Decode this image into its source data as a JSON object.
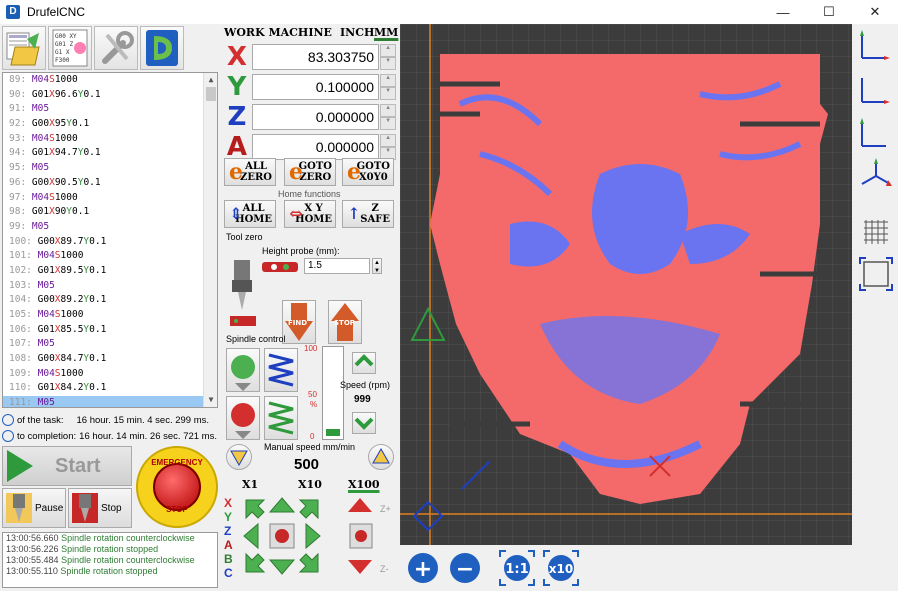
{
  "app": {
    "title": "DrufelCNC",
    "icon": "app-icon"
  },
  "window_controls": {
    "minimize": "—",
    "maximize": "☐",
    "close": "✕"
  },
  "toolbar": {
    "open_file": "open-file-icon",
    "gcode_text": "G01 XY\nG01 Z\nG1 X\nG0 F300",
    "settings": "settings-icon",
    "logo": "drufel-logo-icon"
  },
  "gcode_lines": [
    {
      "n": "89:",
      "parts": [
        [
          "cm",
          "M04"
        ],
        [
          "cx",
          "S"
        ],
        [
          "",
          "1000"
        ]
      ]
    },
    {
      "n": "90:",
      "parts": [
        [
          "",
          "G01"
        ],
        [
          "cx",
          "X"
        ],
        [
          "",
          "96.6"
        ],
        [
          "cy",
          "Y"
        ],
        [
          "",
          "0.1"
        ]
      ]
    },
    {
      "n": "91:",
      "parts": [
        [
          "cm",
          "M05"
        ]
      ]
    },
    {
      "n": "92:",
      "parts": [
        [
          "",
          "G00"
        ],
        [
          "cx",
          "X"
        ],
        [
          "",
          "95"
        ],
        [
          "cy",
          "Y"
        ],
        [
          "",
          "0.1"
        ]
      ]
    },
    {
      "n": "93:",
      "parts": [
        [
          "cm",
          "M04"
        ],
        [
          "cx",
          "S"
        ],
        [
          "",
          "1000"
        ]
      ]
    },
    {
      "n": "94:",
      "parts": [
        [
          "",
          "G01"
        ],
        [
          "cx",
          "X"
        ],
        [
          "",
          "94.7"
        ],
        [
          "cy",
          "Y"
        ],
        [
          "",
          "0.1"
        ]
      ]
    },
    {
      "n": "95:",
      "parts": [
        [
          "cm",
          "M05"
        ]
      ]
    },
    {
      "n": "96:",
      "parts": [
        [
          "",
          "G00"
        ],
        [
          "cx",
          "X"
        ],
        [
          "",
          "90.5"
        ],
        [
          "cy",
          "Y"
        ],
        [
          "",
          "0.1"
        ]
      ]
    },
    {
      "n": "97:",
      "parts": [
        [
          "cm",
          "M04"
        ],
        [
          "cx",
          "S"
        ],
        [
          "",
          "1000"
        ]
      ]
    },
    {
      "n": "98:",
      "parts": [
        [
          "",
          "G01"
        ],
        [
          "cx",
          "X"
        ],
        [
          "",
          "90"
        ],
        [
          "cy",
          "Y"
        ],
        [
          "",
          "0.1"
        ]
      ]
    },
    {
      "n": "99:",
      "parts": [
        [
          "cm",
          "M05"
        ]
      ]
    },
    {
      "n": "100:",
      "parts": [
        [
          "",
          "G00"
        ],
        [
          "cx",
          "X"
        ],
        [
          "",
          "89.7"
        ],
        [
          "cy",
          "Y"
        ],
        [
          "",
          "0.1"
        ]
      ]
    },
    {
      "n": "101:",
      "parts": [
        [
          "cm",
          "M04"
        ],
        [
          "cx",
          "S"
        ],
        [
          "",
          "1000"
        ]
      ]
    },
    {
      "n": "102:",
      "parts": [
        [
          "",
          "G01"
        ],
        [
          "cx",
          "X"
        ],
        [
          "",
          "89.5"
        ],
        [
          "cy",
          "Y"
        ],
        [
          "",
          "0.1"
        ]
      ]
    },
    {
      "n": "103:",
      "parts": [
        [
          "cm",
          "M05"
        ]
      ]
    },
    {
      "n": "104:",
      "parts": [
        [
          "",
          "G00"
        ],
        [
          "cx",
          "X"
        ],
        [
          "",
          "89.2"
        ],
        [
          "cy",
          "Y"
        ],
        [
          "",
          "0.1"
        ]
      ]
    },
    {
      "n": "105:",
      "parts": [
        [
          "cm",
          "M04"
        ],
        [
          "cx",
          "S"
        ],
        [
          "",
          "1000"
        ]
      ]
    },
    {
      "n": "106:",
      "parts": [
        [
          "",
          "G01"
        ],
        [
          "cx",
          "X"
        ],
        [
          "",
          "85.5"
        ],
        [
          "cy",
          "Y"
        ],
        [
          "",
          "0.1"
        ]
      ]
    },
    {
      "n": "107:",
      "parts": [
        [
          "cm",
          "M05"
        ]
      ]
    },
    {
      "n": "108:",
      "parts": [
        [
          "",
          "G00"
        ],
        [
          "cx",
          "X"
        ],
        [
          "",
          "84.7"
        ],
        [
          "cy",
          "Y"
        ],
        [
          "",
          "0.1"
        ]
      ]
    },
    {
      "n": "109:",
      "parts": [
        [
          "cm",
          "M04"
        ],
        [
          "cx",
          "S"
        ],
        [
          "",
          "1000"
        ]
      ]
    },
    {
      "n": "110:",
      "parts": [
        [
          "",
          "G01"
        ],
        [
          "cx",
          "X"
        ],
        [
          "",
          "84.2"
        ],
        [
          "cy",
          "Y"
        ],
        [
          "",
          "0.1"
        ]
      ]
    },
    {
      "n": "111:",
      "parts": [
        [
          "cm",
          "M05"
        ]
      ],
      "selected": true
    }
  ],
  "time": {
    "task_label": "of the task:",
    "task_value": "16 hour. 15 min. 4 sec. 299 ms.",
    "completion_label": "to completion:",
    "completion_value": "16 hour. 14 min. 26 sec. 721 ms."
  },
  "controls": {
    "start": "Start",
    "pause": "Pause",
    "stop": "Stop",
    "estop_top": "EMERGENCY",
    "estop_bottom": "STOP"
  },
  "log": [
    {
      "t": "13:00:56.660",
      "msg": "Spindle rotation counterclockwise"
    },
    {
      "t": "13:00:56.226",
      "msg": "Spindle rotation stopped"
    },
    {
      "t": "13:00:55.484",
      "msg": "Spindle rotation counterclockwise"
    },
    {
      "t": "13:00:55.110",
      "msg": "Spindle rotation stopped"
    }
  ],
  "axes": {
    "header": "WORK MACHINE",
    "inch": "INCH",
    "mm": "MM",
    "rows": [
      {
        "letter": "X",
        "color": "#d32f2f",
        "value": "83.303750"
      },
      {
        "letter": "Y",
        "color": "#2e9a3c",
        "value": "0.100000"
      },
      {
        "letter": "Z",
        "color": "#1e3fbf",
        "value": "0.000000"
      },
      {
        "letter": "A",
        "color": "#b71c1c",
        "value": "0.000000"
      }
    ]
  },
  "home": {
    "all_zero": "ALL\nZERO",
    "goto_zero": "GOTO\nZERO",
    "goto_x0y0": "GOTO\nX0Y0",
    "functions_label": "Home functions",
    "all_home": "ALL\nHOME",
    "xy_home": "X Y\nHOME",
    "z_safe": "Z\nSAFE"
  },
  "tool_zero": {
    "label": "Tool zero",
    "height_probe_label": "Height probe (mm):",
    "height_probe_value": "1.5",
    "find": "FIND",
    "stop": "STOP"
  },
  "spindle": {
    "label": "Spindle control",
    "max": "100",
    "mid": "50",
    "unit": "%",
    "min": "0",
    "level_fraction": 0.08,
    "speed_label": "Speed (rpm)",
    "speed_value": "999"
  },
  "manual_speed": {
    "label": "Manual speed mm/min",
    "value": "500",
    "x1": "X1",
    "x10": "X10",
    "x100": "X100"
  },
  "jog_axes": [
    "X",
    "Y",
    "Z",
    "A",
    "B",
    "C"
  ],
  "jog_labels": {
    "z_plus": "Z+",
    "z_minus": "Z-"
  },
  "zoom": {
    "zoom_in": "+",
    "zoom_out": "−",
    "one_to_one": "1:1",
    "x10": "x10"
  },
  "view_buttons": [
    "view-top-icon",
    "view-front-icon",
    "view-side-icon",
    "view-iso-icon",
    "grid-icon",
    "frame-icon"
  ],
  "colors": {
    "accent_green": "#2e9a3c",
    "engrave_red": "#f46a6a",
    "engrave_blue": "#6b74f0",
    "canvas_bg": "#3c3c3c"
  }
}
